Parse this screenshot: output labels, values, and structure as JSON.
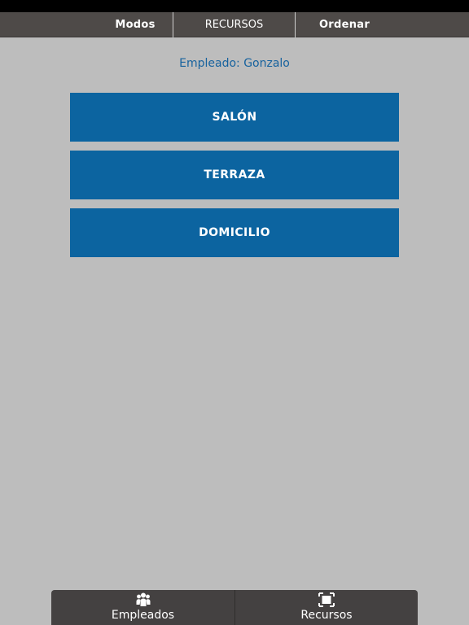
{
  "top_tabs": {
    "modos": "Modos",
    "recursos": "RECURSOS",
    "ordenar": "Ordenar"
  },
  "employee": {
    "label": "Empleado: Gonzalo"
  },
  "modes": [
    {
      "label": "SALÓN"
    },
    {
      "label": "TERRAZA"
    },
    {
      "label": "DOMICILIO"
    }
  ],
  "bottom_tabs": [
    {
      "label": "Empleados",
      "icon": "people-icon"
    },
    {
      "label": "Recursos",
      "icon": "frame-icon"
    }
  ],
  "colors": {
    "background": "#bdbdbd",
    "topbar": "#4e4a48",
    "button": "#0c64a0",
    "employee_text": "#17629e",
    "bottombar": "#444141"
  }
}
